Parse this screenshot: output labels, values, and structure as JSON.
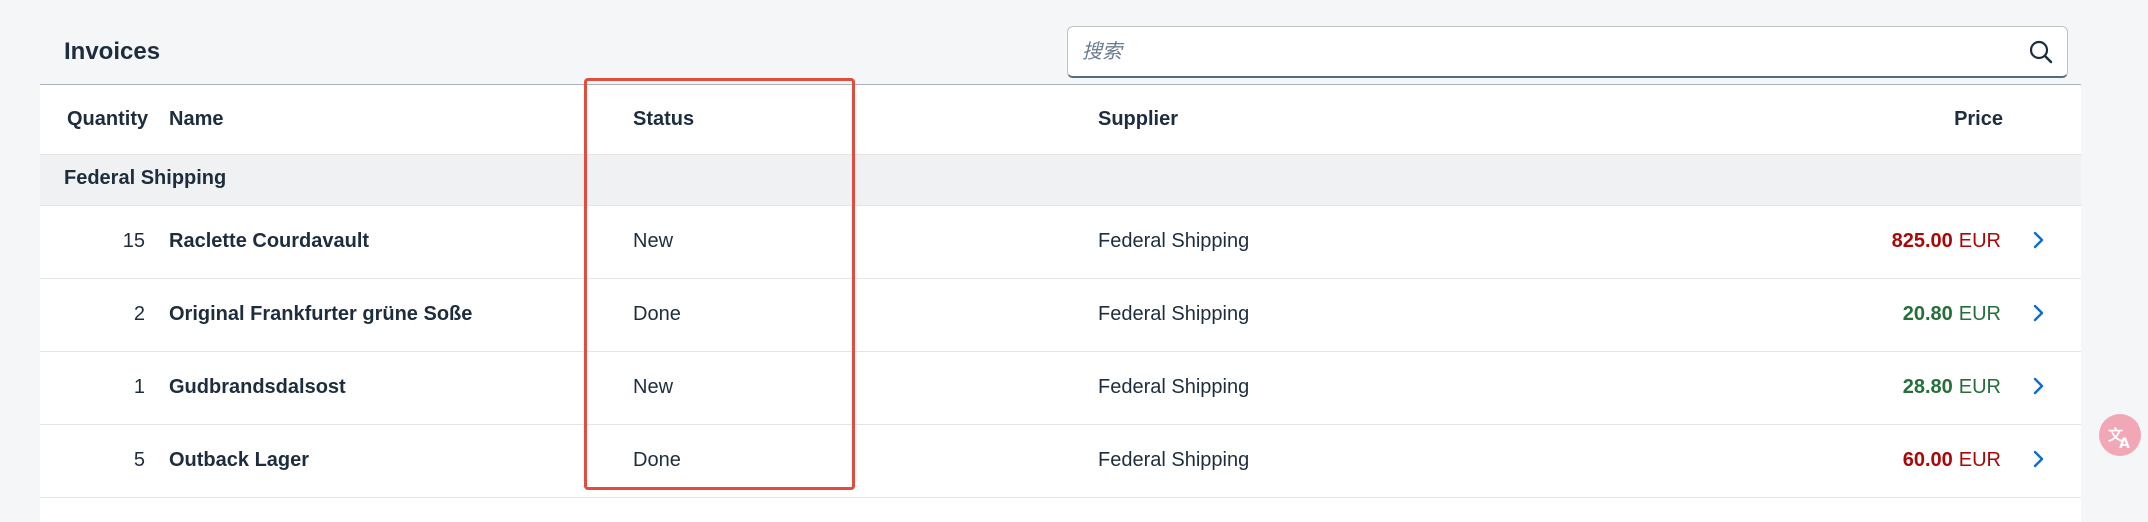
{
  "header": {
    "title": "Invoices"
  },
  "search": {
    "placeholder": "搜索",
    "value": ""
  },
  "columns": {
    "quantity": "Quantity",
    "name": "Name",
    "status": "Status",
    "supplier": "Supplier",
    "price": "Price"
  },
  "group": {
    "label": "Federal Shipping"
  },
  "rows": [
    {
      "quantity": "15",
      "name": "Raclette Courdavault",
      "status": "New",
      "supplier": "Federal Shipping",
      "price": "825.00",
      "currency": "EUR",
      "state": "error"
    },
    {
      "quantity": "2",
      "name": "Original Frankfurter grüne Soße",
      "status": "Done",
      "supplier": "Federal Shipping",
      "price": "20.80",
      "currency": "EUR",
      "state": "good"
    },
    {
      "quantity": "1",
      "name": "Gudbrandsdalsost",
      "status": "New",
      "supplier": "Federal Shipping",
      "price": "28.80",
      "currency": "EUR",
      "state": "good"
    },
    {
      "quantity": "5",
      "name": "Outback Lager",
      "status": "Done",
      "supplier": "Federal Shipping",
      "price": "60.00",
      "currency": "EUR",
      "state": "error"
    }
  ],
  "colors": {
    "error_price": "#aa0808",
    "good_price": "#256f3a",
    "nav_arrow": "#0a6ed1",
    "highlight": "#e24c3f"
  },
  "icons": {
    "search": "search-icon",
    "navigation": "chevron-right-icon",
    "translate": "translate-icon"
  }
}
